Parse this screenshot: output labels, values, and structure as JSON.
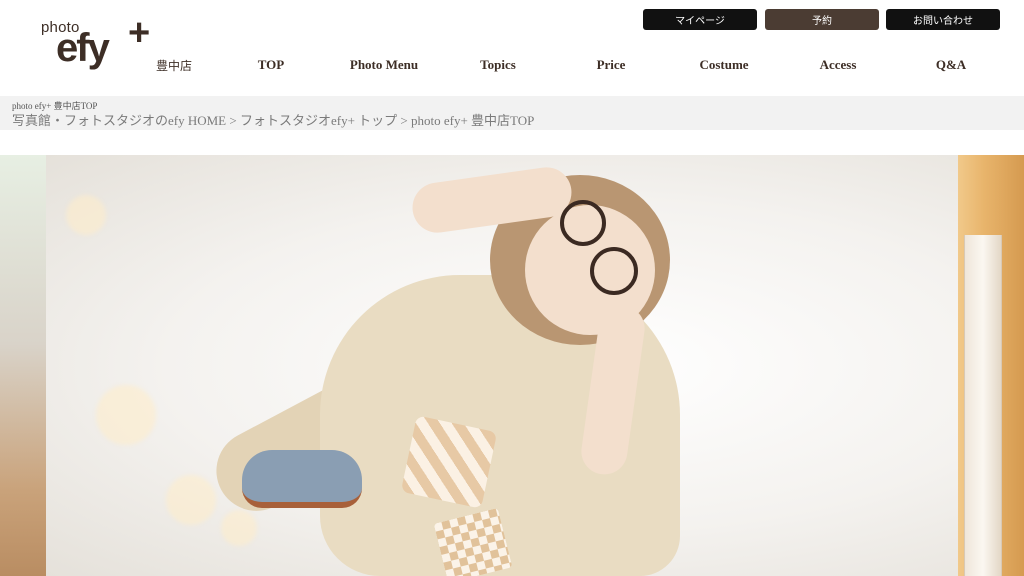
{
  "header": {
    "logo": {
      "photo_text": "photo",
      "brand_text": "efy",
      "plus_text": "+"
    },
    "store_name": "豊中店",
    "top_buttons": {
      "mypage": "マイページ",
      "reserve": "予約",
      "contact": "お問い合わせ"
    },
    "nav": [
      {
        "label": "TOP"
      },
      {
        "label": "Photo Menu"
      },
      {
        "label": "Topics"
      },
      {
        "label": "Price"
      },
      {
        "label": "Costume"
      },
      {
        "label": "Access"
      },
      {
        "label": "Q&A"
      }
    ]
  },
  "breadcrumb": {
    "small": "photo efy+ 豊中店TOP",
    "items": [
      {
        "label": "写真館・フォトスタジオのefy HOME"
      },
      {
        "label": "フォトスタジオefy+ トップ"
      },
      {
        "label": "photo efy+ 豊中店TOP"
      }
    ],
    "separator": ">"
  },
  "colors": {
    "brand": "#3d2e26",
    "button_dark": "#111111",
    "button_reserve": "#4b3c33",
    "breadcrumb_bg": "#f2f2f2"
  }
}
